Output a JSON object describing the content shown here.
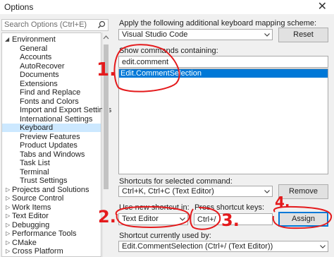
{
  "window": {
    "title": "Options",
    "close_glyph": "✕"
  },
  "sidebar": {
    "search_placeholder": "Search Options (Ctrl+E)",
    "items": [
      {
        "label": "Environment",
        "expanded": true
      },
      {
        "label": "General"
      },
      {
        "label": "Accounts"
      },
      {
        "label": "AutoRecover"
      },
      {
        "label": "Documents"
      },
      {
        "label": "Extensions"
      },
      {
        "label": "Find and Replace"
      },
      {
        "label": "Fonts and Colors"
      },
      {
        "label": "Import and Export Settings"
      },
      {
        "label": "International Settings"
      },
      {
        "label": "Keyboard",
        "selected": true
      },
      {
        "label": "Preview Features"
      },
      {
        "label": "Product Updates"
      },
      {
        "label": "Tabs and Windows"
      },
      {
        "label": "Task List"
      },
      {
        "label": "Terminal"
      },
      {
        "label": "Trust Settings"
      },
      {
        "label": "Projects and Solutions",
        "collapsed": true
      },
      {
        "label": "Source Control",
        "collapsed": true
      },
      {
        "label": "Work Items",
        "collapsed": true
      },
      {
        "label": "Text Editor",
        "collapsed": true
      },
      {
        "label": "Debugging",
        "collapsed": true
      },
      {
        "label": "Performance Tools",
        "collapsed": true
      },
      {
        "label": "CMake",
        "collapsed": true
      },
      {
        "label": "Cross Platform",
        "collapsed": true
      }
    ]
  },
  "main": {
    "mapping_label": "Apply the following additional keyboard mapping scheme:",
    "mapping_value": "Visual Studio Code",
    "reset_label": "Reset",
    "show_commands_label": "Show commands containing:",
    "command_filter_value": "edit.comment",
    "command_results": [
      "Edit.CommentSelection"
    ],
    "shortcuts_label": "Shortcuts for selected command:",
    "shortcut_value": "Ctrl+K, Ctrl+C (Text Editor)",
    "remove_label": "Remove",
    "use_shortcut_label": "Use new shortcut in:",
    "scope_value": "Text Editor",
    "press_keys_label": "Press shortcut keys:",
    "pressed_keys_value": "Ctrl+/",
    "assign_label": "Assign",
    "currently_used_label": "Shortcut currently used by:",
    "currently_used_value": "Edit.CommentSelection (Ctrl+/ (Text Editor))"
  },
  "annotations": {
    "step1": "1.",
    "step2": "2.",
    "step3": "3.",
    "step4": "4."
  },
  "colors": {
    "annotation": "#e41a1c",
    "selection": "#0078d7",
    "tree_selection": "#cce8ff"
  }
}
